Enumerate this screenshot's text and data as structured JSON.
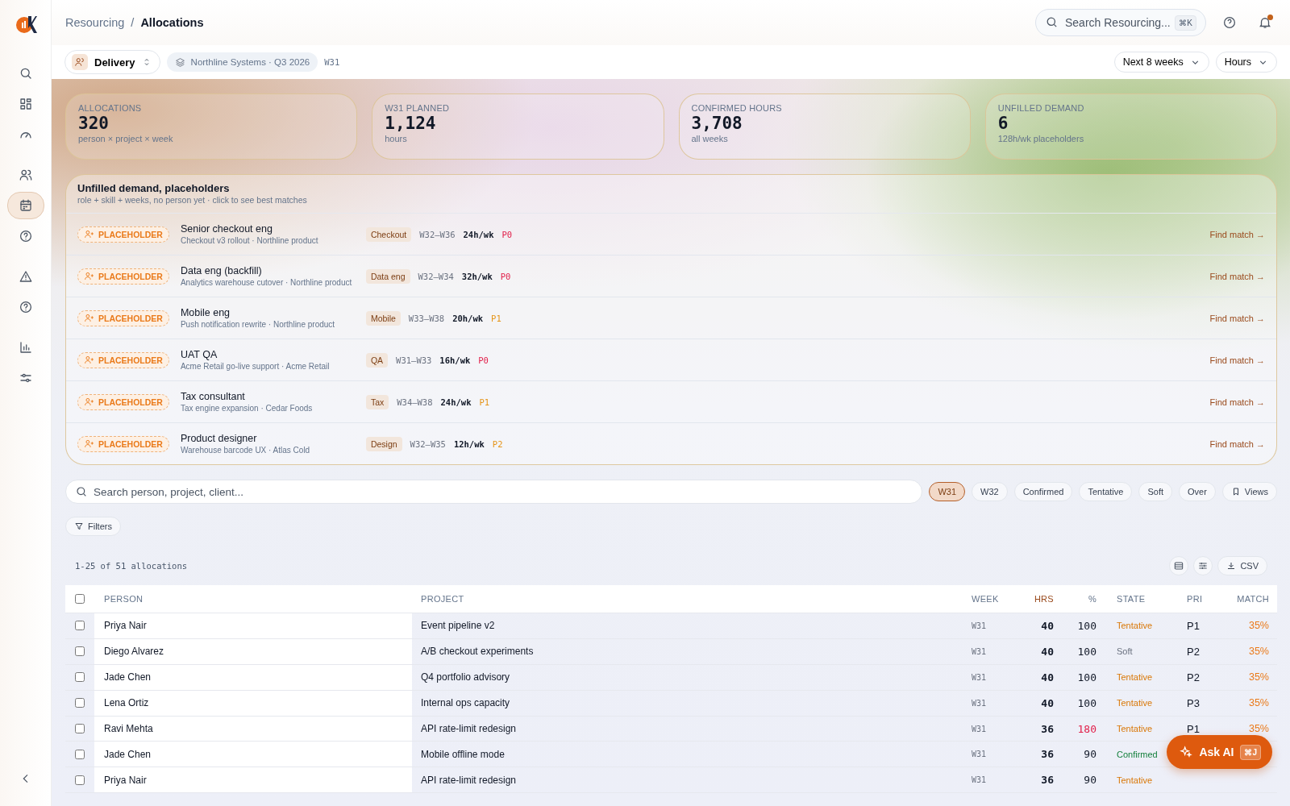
{
  "sidebar": {
    "items": [
      {
        "selected": false
      },
      {
        "selected": false
      },
      {
        "selected": false
      },
      {
        "selected": false
      },
      {
        "selected": true
      },
      {
        "selected": false
      },
      {
        "selected": false
      },
      {
        "selected": false
      },
      {
        "selected": false
      },
      {
        "selected": false
      }
    ]
  },
  "breadcrumb": {
    "parent": "Resourcing",
    "separator": "/",
    "current": "Allocations"
  },
  "search": {
    "placeholder": "Search Resourcing...",
    "shortcut": "⌘K"
  },
  "notifications": {
    "unread": true
  },
  "context": {
    "team": "Delivery",
    "scope": "Northline Systems · Q3 2026",
    "week": "W31",
    "range": "Next 8 weeks",
    "unit": "Hours"
  },
  "stats": [
    {
      "label": "ALLOCATIONS",
      "value": "320",
      "note": "person × project × week"
    },
    {
      "label": "W31 PLANNED",
      "value": "1,124",
      "note": "hours"
    },
    {
      "label": "CONFIRMED HOURS",
      "value": "3,708",
      "note": "all weeks"
    },
    {
      "label": "UNFILLED DEMAND",
      "value": "6",
      "note": "128h/wk placeholders"
    }
  ],
  "placeholders": {
    "title": "Unfilled demand, placeholders",
    "subtitle": "role + skill + weeks, no person yet · click to see best matches",
    "items": [
      {
        "badge": "PLACEHOLDER",
        "role": "Senior checkout eng",
        "project": "Checkout v3 rollout · Northline product",
        "skill": "Checkout",
        "weeks": "W32–W36",
        "hours": "24h/wk",
        "priority": "P0",
        "urgent": true,
        "action": "Find match →"
      },
      {
        "badge": "PLACEHOLDER",
        "role": "Data eng (backfill)",
        "project": "Analytics warehouse cutover · Northline product",
        "skill": "Data eng",
        "weeks": "W32–W34",
        "hours": "32h/wk",
        "priority": "P0",
        "urgent": true,
        "action": "Find match →"
      },
      {
        "badge": "PLACEHOLDER",
        "role": "Mobile eng",
        "project": "Push notification rewrite · Northline product",
        "skill": "Mobile",
        "weeks": "W33–W38",
        "hours": "20h/wk",
        "priority": "P1",
        "urgent": false,
        "action": "Find match →"
      },
      {
        "badge": "PLACEHOLDER",
        "role": "UAT QA",
        "project": "Acme Retail go-live support · Acme Retail",
        "skill": "QA",
        "weeks": "W31–W33",
        "hours": "16h/wk",
        "priority": "P0",
        "urgent": true,
        "action": "Find match →"
      },
      {
        "badge": "PLACEHOLDER",
        "role": "Tax consultant",
        "project": "Tax engine expansion · Cedar Foods",
        "skill": "Tax",
        "weeks": "W34–W38",
        "hours": "24h/wk",
        "priority": "P1",
        "urgent": false,
        "action": "Find match →"
      },
      {
        "badge": "PLACEHOLDER",
        "role": "Product designer",
        "project": "Warehouse barcode UX · Atlas Cold",
        "skill": "Design",
        "weeks": "W32–W35",
        "hours": "12h/wk",
        "priority": "P2",
        "urgent": false,
        "action": "Find match →"
      }
    ]
  },
  "filter_bar": {
    "placeholder": "Search person, project, client...",
    "chips": [
      {
        "label": "W31",
        "selected": true
      },
      {
        "label": "W32",
        "selected": false
      },
      {
        "label": "Confirmed",
        "selected": false
      },
      {
        "label": "Tentative",
        "selected": false
      },
      {
        "label": "Soft",
        "selected": false
      },
      {
        "label": "Over",
        "selected": false
      }
    ],
    "views": "Views",
    "filters": "Filters"
  },
  "table": {
    "count": "1-25 of 51 allocations",
    "csv": "CSV",
    "select_all_checked": false,
    "columns": [
      "PERSON",
      "PROJECT",
      "WEEK",
      "HRS",
      "%",
      "STATE",
      "PRI",
      "MATCH"
    ],
    "rows": [
      {
        "checked": false,
        "person": "Priya Nair",
        "project": "Event pipeline v2",
        "week": "W31",
        "hrs": "40",
        "pct": "100",
        "over": false,
        "state": "Tentative",
        "color": "#d97706",
        "pri": "P1",
        "match": "35%"
      },
      {
        "checked": false,
        "person": "Diego Alvarez",
        "project": "A/B checkout experiments",
        "week": "W31",
        "hrs": "40",
        "pct": "100",
        "over": false,
        "state": "Soft",
        "color": "#6b7280",
        "pri": "P2",
        "match": "35%"
      },
      {
        "checked": false,
        "person": "Jade Chen",
        "project": "Q4 portfolio advisory",
        "week": "W31",
        "hrs": "40",
        "pct": "100",
        "over": false,
        "state": "Tentative",
        "color": "#d97706",
        "pri": "P2",
        "match": "35%"
      },
      {
        "checked": false,
        "person": "Lena Ortiz",
        "project": "Internal ops capacity",
        "week": "W31",
        "hrs": "40",
        "pct": "100",
        "over": false,
        "state": "Tentative",
        "color": "#d97706",
        "pri": "P3",
        "match": "35%"
      },
      {
        "checked": false,
        "person": "Ravi Mehta",
        "project": "API rate-limit redesign",
        "week": "W31",
        "hrs": "36",
        "pct": "180",
        "over": true,
        "state": "Tentative",
        "color": "#d97706",
        "pri": "P1",
        "match": "35%"
      },
      {
        "checked": false,
        "person": "Jade Chen",
        "project": "Mobile offline mode",
        "week": "W31",
        "hrs": "36",
        "pct": "90",
        "over": false,
        "state": "Confirmed",
        "color": "#15803d"
      },
      {
        "checked": false,
        "person": "Priya Nair",
        "project": "API rate-limit redesign",
        "week": "W31",
        "hrs": "36",
        "pct": "90",
        "over": false,
        "state": "Tentative",
        "color": "#d97706"
      }
    ]
  },
  "ask_ai": {
    "label": "Ask AI",
    "shortcut": "⌘J"
  }
}
